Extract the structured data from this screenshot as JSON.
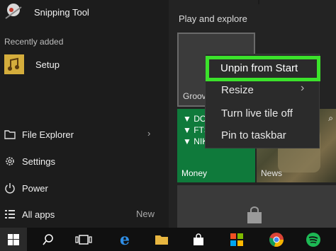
{
  "start_menu": {
    "apps": [
      {
        "label": "Snipping Tool",
        "icon": "snipping-tool-icon"
      },
      {
        "label": "Setup",
        "icon": "setup-icon"
      }
    ],
    "recently_added_header": "Recently added",
    "system_items": [
      {
        "label": "File Explorer",
        "icon": "folder-icon",
        "has_arrow": true
      },
      {
        "label": "Settings",
        "icon": "gear-icon"
      },
      {
        "label": "Power",
        "icon": "power-icon"
      },
      {
        "label": "All apps",
        "icon": "list-icon",
        "badge": "New"
      }
    ]
  },
  "tiles": {
    "section_header": "Play and explore",
    "groove_label": "Groov",
    "money": {
      "label": "Money",
      "tickers": [
        "DOV",
        "FTSI",
        "NIK"
      ]
    },
    "news_label": "News"
  },
  "context_menu": {
    "items": [
      {
        "label": "Unpin from Start",
        "highlighted": true
      },
      {
        "label": "Resize",
        "has_submenu": true
      },
      {
        "label": "Turn live tile off"
      },
      {
        "label": "Pin to taskbar"
      }
    ],
    "highlight_color": "#3be22b"
  },
  "taskbar": {
    "icons": [
      "windows-start-icon",
      "search-icon",
      "task-view-icon",
      "edge-icon",
      "file-explorer-icon",
      "store-icon",
      "windows-media-icon",
      "chrome-icon",
      "spotify-icon"
    ]
  },
  "colors": {
    "accent_green": "#3be22b",
    "money_tile": "#0f7a3b",
    "store_tile": "#3a3a3a"
  }
}
